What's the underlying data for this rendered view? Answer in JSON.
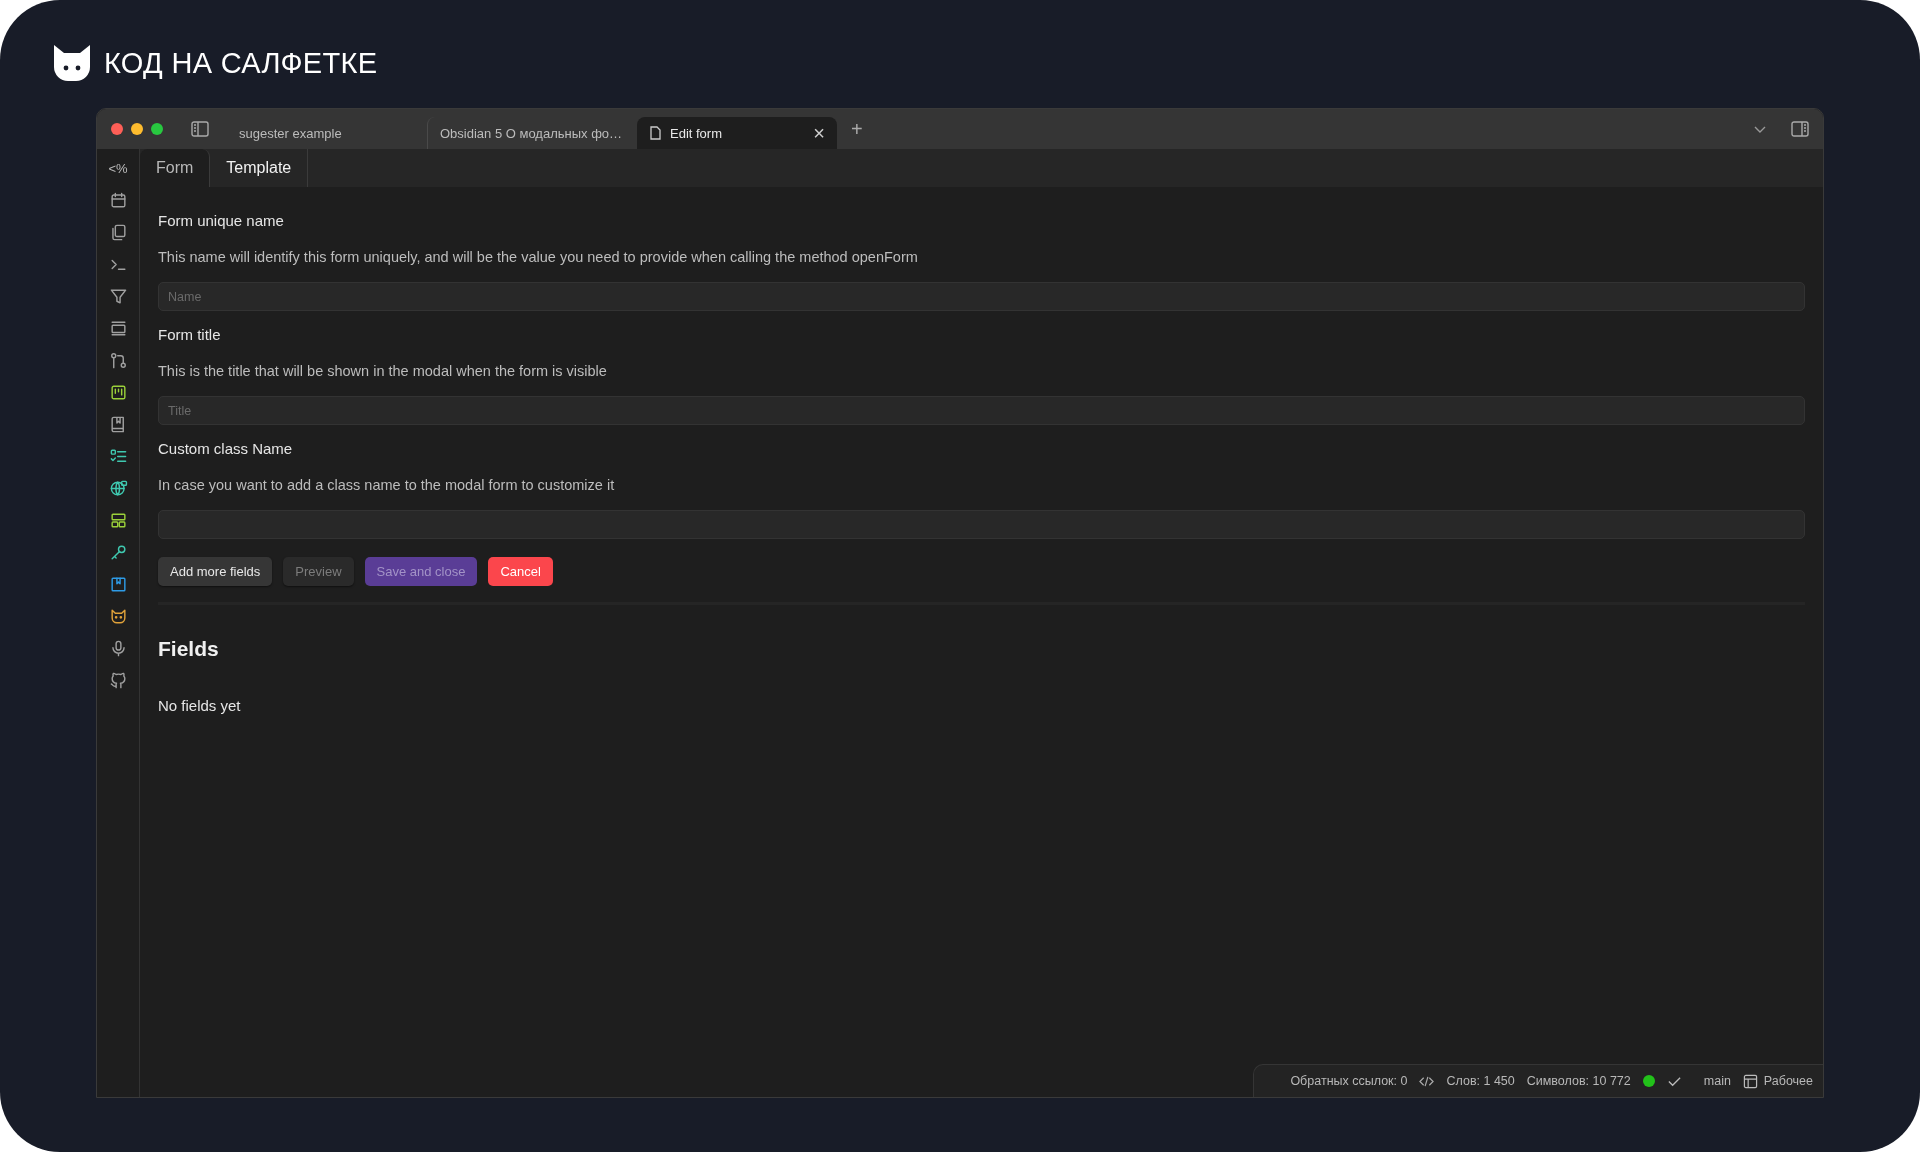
{
  "brand": {
    "name": "КОД НА САЛФЕТКЕ"
  },
  "window": {
    "tabs": [
      {
        "label": "sugester example",
        "selected": false
      },
      {
        "label": "Obsidian 5 О модальных фо…",
        "selected": false
      },
      {
        "label": "Edit form",
        "selected": true,
        "close": "×"
      }
    ],
    "new_tab": "+"
  },
  "ribbon": [
    {
      "kind": "text",
      "text": "<%"
    },
    {
      "kind": "calendar"
    },
    {
      "kind": "copy"
    },
    {
      "kind": "terminal"
    },
    {
      "kind": "filter"
    },
    {
      "kind": "slides"
    },
    {
      "kind": "git"
    },
    {
      "kind": "kanban"
    },
    {
      "kind": "book"
    },
    {
      "kind": "tasks"
    },
    {
      "kind": "globe"
    },
    {
      "kind": "layout"
    },
    {
      "kind": "key"
    },
    {
      "kind": "bookmark"
    },
    {
      "kind": "cat"
    },
    {
      "kind": "mic"
    },
    {
      "kind": "github"
    }
  ],
  "view_tabs": [
    {
      "label": "Form",
      "selected": false
    },
    {
      "label": "Template",
      "selected": true
    }
  ],
  "form": {
    "sections": [
      {
        "title": "Form unique name",
        "description": "This name will identify this form uniquely, and will be the value you need to provide when calling the method openForm",
        "placeholder": "Name"
      },
      {
        "title": "Form title",
        "description": "This is the title that will be shown in the modal when the form is visible",
        "placeholder": "Title"
      },
      {
        "title": "Custom class Name",
        "description": "In case you want to add a class name to the modal form to customize it"
      }
    ],
    "buttons": [
      {
        "label": "Add more fields",
        "kind": "default",
        "disabled": false
      },
      {
        "label": "Preview",
        "kind": "default",
        "disabled": true
      },
      {
        "label": "Save and close",
        "kind": "primary",
        "disabled": true
      },
      {
        "label": "Cancel",
        "kind": "danger",
        "disabled": false
      }
    ]
  },
  "fields": {
    "heading": "Fields",
    "empty": "No fields yet"
  },
  "status_bar": {
    "backlinks": "Обратных ссылок: 0",
    "words": "Слов: 1 450",
    "chars": "Символов: 10 772",
    "sync": {
      "color": "#22c11a"
    },
    "branch": "main",
    "workspace": "Рабочее"
  }
}
